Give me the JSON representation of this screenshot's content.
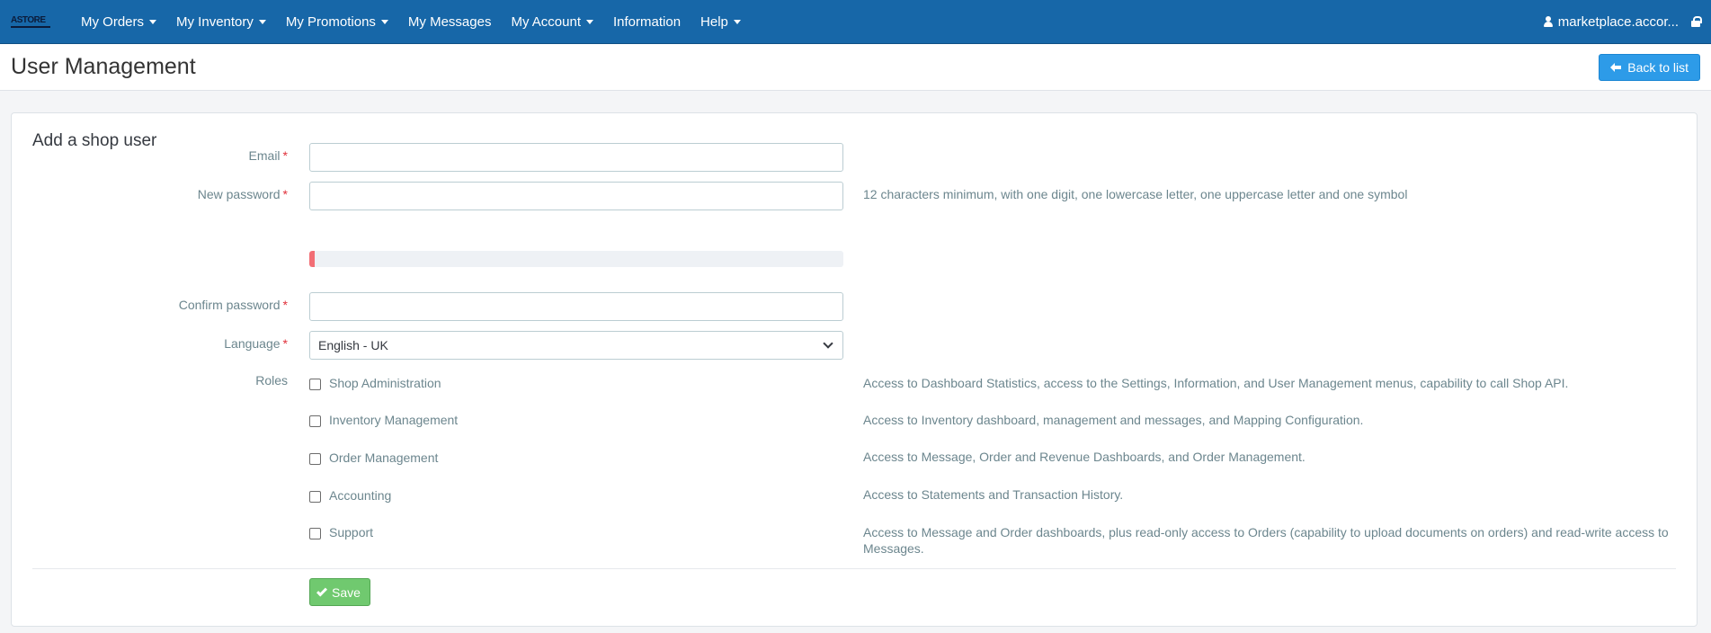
{
  "nav": {
    "logo_text": "ASTORE",
    "items": [
      {
        "label": "My Orders",
        "dropdown": true
      },
      {
        "label": "My Inventory",
        "dropdown": true
      },
      {
        "label": "My Promotions",
        "dropdown": true
      },
      {
        "label": "My Messages",
        "dropdown": false
      },
      {
        "label": "My Account",
        "dropdown": true
      },
      {
        "label": "Information",
        "dropdown": false
      },
      {
        "label": "Help",
        "dropdown": true
      }
    ],
    "user": "marketplace.accor..."
  },
  "header": {
    "title": "User Management",
    "back_label": "Back to list"
  },
  "form": {
    "title": "Add a shop user",
    "email_label": "Email",
    "new_password_label": "New password",
    "password_help": "12 characters minimum, with one digit, one lowercase letter, one uppercase letter and one symbol",
    "password_strength": 0.01,
    "confirm_password_label": "Confirm password",
    "language_label": "Language",
    "language_value": "English - UK",
    "roles_label": "Roles",
    "required_mark": "*",
    "roles": [
      {
        "name": "Shop Administration",
        "description": "Access to Dashboard Statistics, access to the Settings, Information, and User Management menus, capability to call Shop API.",
        "checked": false
      },
      {
        "name": "Inventory Management",
        "description": "Access to Inventory dashboard, management and messages, and Mapping Configuration.",
        "checked": false
      },
      {
        "name": "Order Management",
        "description": "Access to Message, Order and Revenue Dashboards, and Order Management.",
        "checked": false
      },
      {
        "name": "Accounting",
        "description": "Access to Statements and Transaction History.",
        "checked": false
      },
      {
        "name": "Support",
        "description": "Access to Message and Order dashboards, plus read-only access to Orders (capability to upload documents on orders) and read-write access to Messages.",
        "checked": false
      }
    ],
    "save_label": "Save"
  },
  "colors": {
    "nav_bg": "#1767a8",
    "primary": "#2d9be8",
    "success": "#70c96f",
    "danger": "#f26e75"
  }
}
